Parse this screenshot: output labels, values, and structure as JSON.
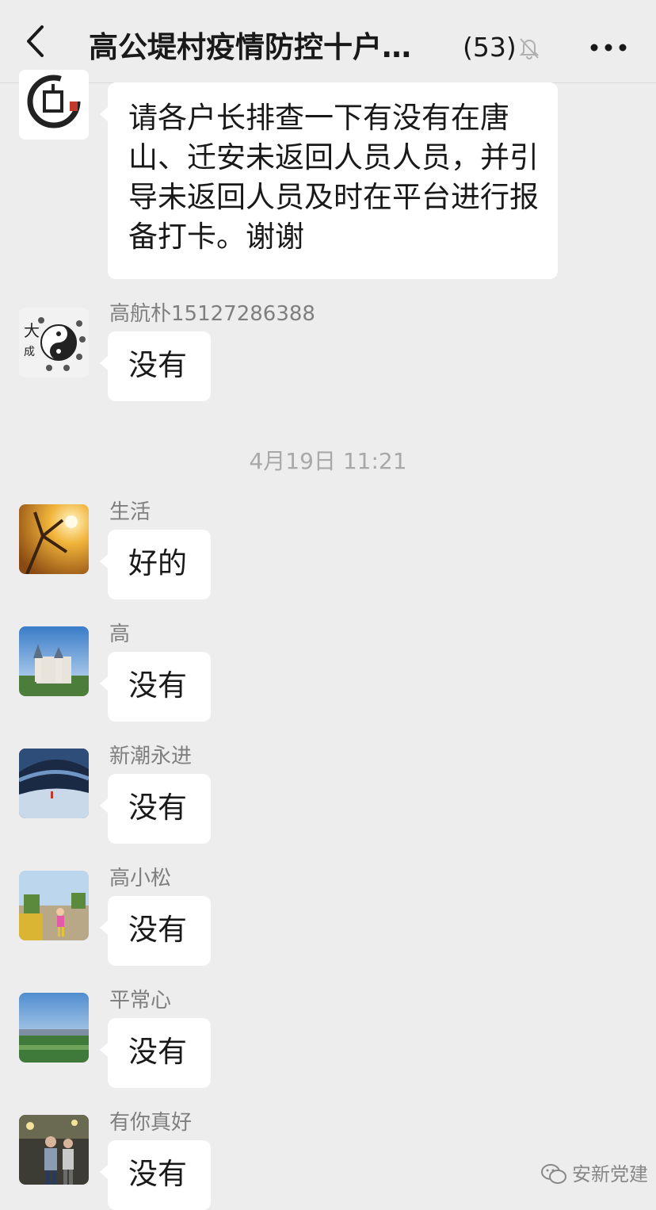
{
  "header": {
    "title": "高公堤村疫情防控十户…",
    "member_count": "(53)",
    "back_icon": "chevron-left-icon",
    "mute_icon": "bell-off-icon",
    "more_icon": "more-dots-icon"
  },
  "messages": [
    {
      "sender": "",
      "text": "请各户长排查一下有没有在唐山、迁安未返回人员人员，并引导未返回人员及时在平台进行报备打卡。谢谢",
      "avatar": "calligraphy-avatar"
    },
    {
      "sender": "高航朴15127286388",
      "text": "没有",
      "avatar": "taiji-avatar"
    }
  ],
  "timestamp": "4月19日 11:21",
  "messages_after": [
    {
      "sender": "生活",
      "text": "好的",
      "avatar": "autumn-tree-avatar"
    },
    {
      "sender": "高",
      "text": "没有",
      "avatar": "castle-avatar"
    },
    {
      "sender": "新潮永进",
      "text": "没有",
      "avatar": "ice-cave-avatar"
    },
    {
      "sender": "高小松",
      "text": "没有",
      "avatar": "child-park-avatar"
    },
    {
      "sender": "平常心",
      "text": "没有",
      "avatar": "landscape-avatar"
    },
    {
      "sender": "有你真好",
      "text": "没有",
      "avatar": "people-street-avatar"
    }
  ],
  "watermark": {
    "text": "安新党建",
    "icon": "wechat-icon"
  },
  "colors": {
    "background": "#ededed",
    "bubble": "#ffffff",
    "sender": "#7f7f7f",
    "timestamp": "#a8a8a8"
  }
}
